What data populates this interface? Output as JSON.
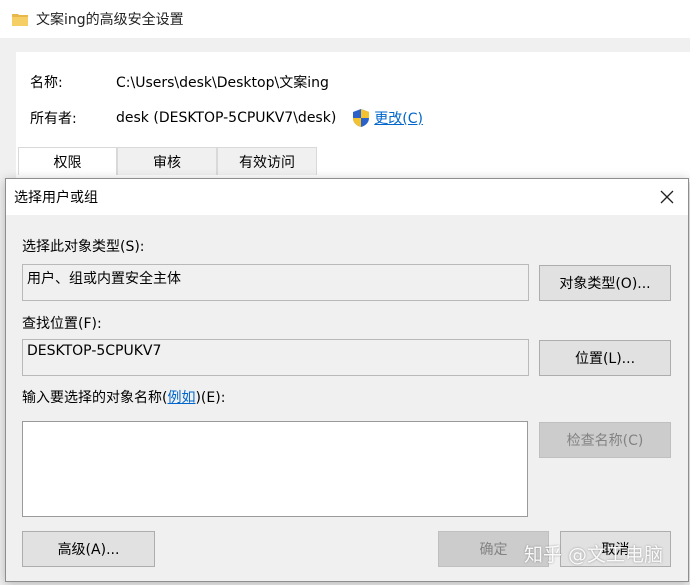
{
  "background_window": {
    "title": "文案ing的高级安全设置",
    "name_label": "名称:",
    "name_value": "C:\\Users\\desk\\Desktop\\文案ing",
    "owner_label": "所有者:",
    "owner_value": "desk (DESKTOP-5CPUKV7\\desk)",
    "change_link": "更改(C)",
    "tabs": [
      {
        "label": "权限"
      },
      {
        "label": "审核"
      },
      {
        "label": "有效访问"
      }
    ]
  },
  "dialog": {
    "title": "选择用户或组",
    "object_types_label": "选择此对象类型(S):",
    "object_types_value": "用户、组或内置安全主体",
    "object_types_button": "对象类型(O)...",
    "location_label": "查找位置(F):",
    "location_value": "DESKTOP-5CPUKV7",
    "location_button": "位置(L)...",
    "enter_label_prefix": "输入要选择的对象名称(",
    "enter_label_link": "例如",
    "enter_label_suffix": ")(E):",
    "object_names_value": "",
    "check_names_button": "检查名称(C)",
    "advanced_button": "高级(A)...",
    "ok_button": "确定",
    "cancel_button": "取消"
  },
  "watermark": "知乎 @文工电脑",
  "colors": {
    "link": "#0066cc",
    "dialog_bg": "#f0f0f0",
    "disabled_text": "#838383"
  }
}
